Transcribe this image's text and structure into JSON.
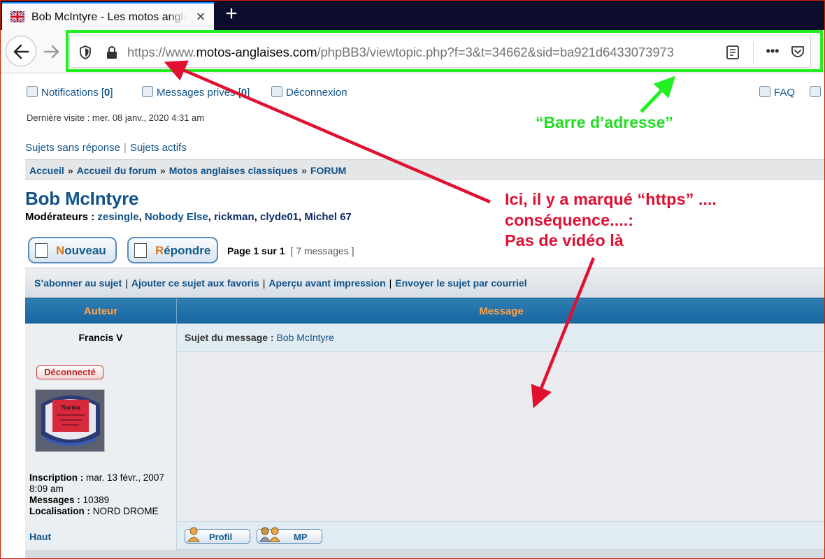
{
  "browser": {
    "tab_title": "Bob McIntyre - Les motos anglaises",
    "new_tab_symbol": "+",
    "close_symbol": "×",
    "url_prefix": "https://www.",
    "url_domain": "motos-anglaises.com",
    "url_path": "/phpBB3/viewtopic.php?f=3&t=34662&sid=ba921d6433073973",
    "more_symbol": "•••"
  },
  "header": {
    "notifications_label": "Notifications [",
    "notifications_count": "0",
    "messages_label": "Messages privés [",
    "messages_count": "0",
    "logout_label": "Déconnexion",
    "faq_label": "FAQ",
    "last_visit": "Dernière visite : mer. 08 janv., 2020 4:31 am"
  },
  "quicklinks": {
    "unanswered": "Sujets sans réponse",
    "active": "Sujets actifs",
    "separator": "|"
  },
  "breadcrumbs": {
    "items": [
      "Accueil",
      "Accueil du forum",
      "Motos anglaises classiques",
      "FORUM"
    ],
    "separator": "»"
  },
  "topic": {
    "title": "Bob McIntyre",
    "moderators_label": "Modérateurs :",
    "moderators": [
      "zesingle",
      "Nobody Else",
      "rickman",
      "clyde01",
      "Michel 67"
    ]
  },
  "buttons": {
    "new_first": "N",
    "new_rest": "ouveau",
    "reply_first": "R",
    "reply_rest": "épondre"
  },
  "pagination": {
    "text": "Page 1 sur 1",
    "count": "[ 7 messages ]"
  },
  "actions": {
    "subscribe": "S’abonner au sujet",
    "bookmark": "Ajouter ce sujet aux favoris",
    "print": "Aperçu avant impression",
    "email": "Envoyer le sujet par courriel",
    "separator": "|"
  },
  "table": {
    "col_author": "Auteur",
    "col_message": "Message"
  },
  "post": {
    "author": "Francis V",
    "subject_label": "Sujet du message :",
    "subject_value": "Bob McIntyre",
    "status": "Déconnecté",
    "inscription_label": "Inscription :",
    "inscription_value": "mar. 13 févr., 2007 8:09 am",
    "messages_label": "Messages :",
    "messages_value": "10389",
    "location_label": "Localisation :",
    "location_value": "NORD DROME",
    "top_link": "Haut",
    "profile_button": "Profil",
    "pm_button": "MP"
  },
  "annotations": {
    "green_label": "“Barre d’adresse”",
    "red_line1": "Ici, il y a marqué “https” ....",
    "red_line2": "conséquence....:",
    "red_line3": "Pas de vidéo là",
    "green_color": "#22dd22",
    "red_color": "#dd1133"
  },
  "avatar_logo_text": "Norton"
}
